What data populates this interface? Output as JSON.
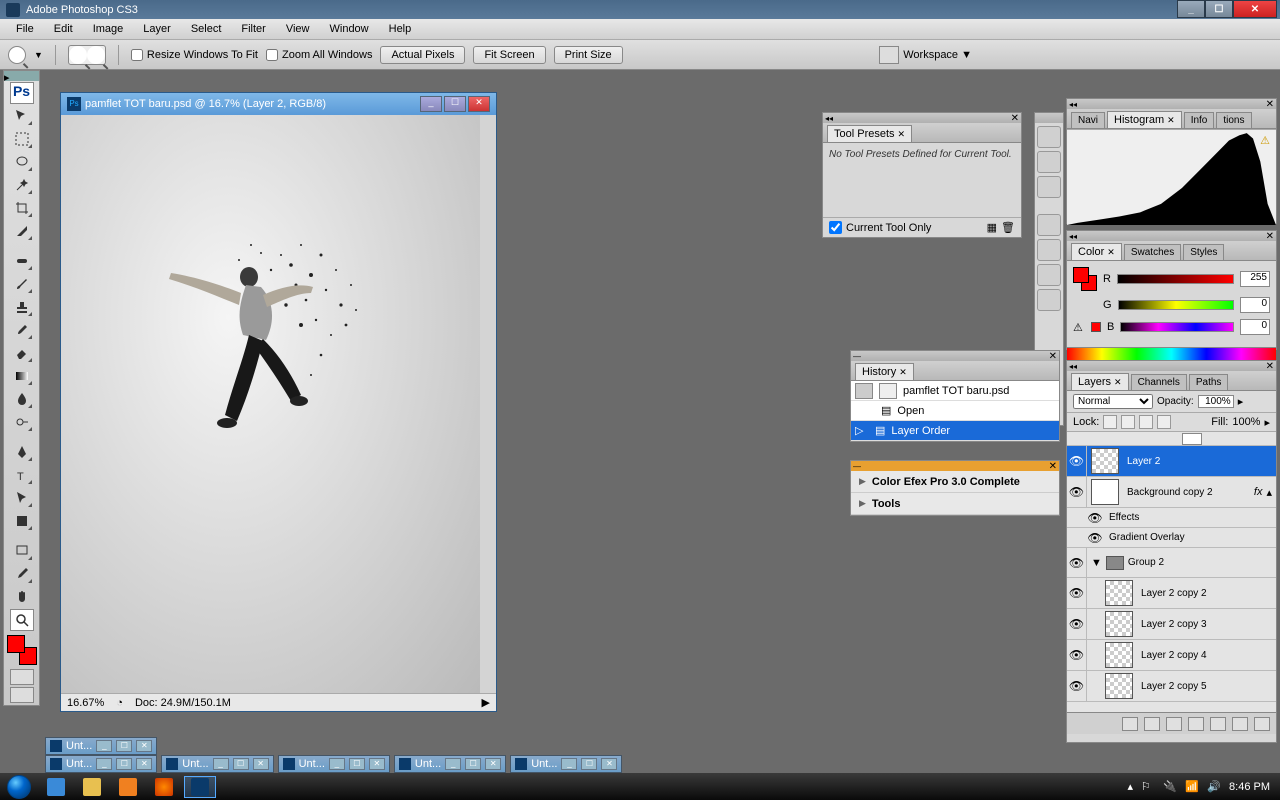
{
  "title": "Adobe Photoshop CS3",
  "menus": [
    "File",
    "Edit",
    "Image",
    "Layer",
    "Select",
    "Filter",
    "View",
    "Window",
    "Help"
  ],
  "options": {
    "resize_fit": "Resize Windows To Fit",
    "zoom_all": "Zoom All Windows",
    "actual_pixels": "Actual Pixels",
    "fit_screen": "Fit Screen",
    "print_size": "Print Size",
    "workspace": "Workspace ▼"
  },
  "document": {
    "title": "pamflet TOT baru.psd @ 16.7% (Layer 2, RGB/8)",
    "zoom": "16.67%",
    "docinfo": "Doc: 24.9M/150.1M"
  },
  "doctab_label": "Unt...",
  "tool_presets": {
    "tab": "Tool Presets",
    "msg": "No Tool Presets Defined for Current Tool.",
    "current_only": "Current Tool Only"
  },
  "histogram_tabs": [
    "Navi",
    "Histogram",
    "Info",
    "tions"
  ],
  "color_tabs": [
    "Color",
    "Swatches",
    "Styles"
  ],
  "color": {
    "r_label": "R",
    "g_label": "G",
    "b_label": "B",
    "r": "255",
    "g": "0",
    "b": "0"
  },
  "history": {
    "tab": "History",
    "file": "pamflet TOT baru.psd",
    "items": [
      "Open",
      "Layer Order"
    ]
  },
  "nik": {
    "items": [
      "Color Efex Pro 3.0 Complete",
      "Tools"
    ]
  },
  "layers": {
    "tabs": [
      "Layers",
      "Channels",
      "Paths"
    ],
    "blend": "Normal",
    "opacity_label": "Opacity:",
    "opacity": "100%",
    "lock_label": "Lock:",
    "fill_label": "Fill:",
    "fill": "100%",
    "items": [
      {
        "name": "Layer 2",
        "sel": true
      },
      {
        "name": "Background copy 2",
        "fx": true
      },
      {
        "name": "Effects",
        "sub": true
      },
      {
        "name": "Gradient Overlay",
        "sub": true
      },
      {
        "name": "Group 2",
        "grp": true
      },
      {
        "name": "Layer 2 copy 2"
      },
      {
        "name": "Layer 2 copy 3"
      },
      {
        "name": "Layer 2 copy 4"
      },
      {
        "name": "Layer 2 copy 5"
      }
    ]
  },
  "taskbar": {
    "time": "8:46 PM"
  }
}
